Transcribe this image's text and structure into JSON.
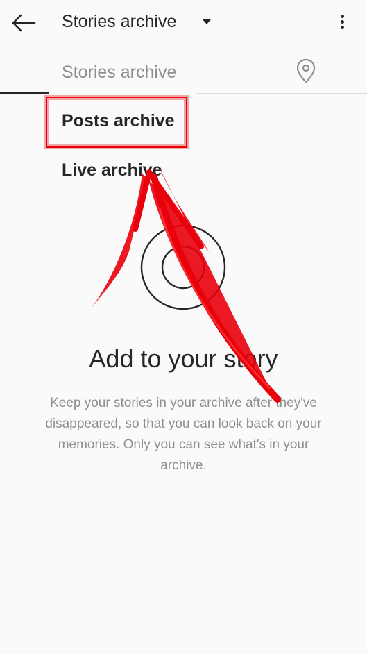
{
  "header": {
    "title": "Stories archive",
    "back_icon": "arrow-left-icon",
    "menu_icon": "more-vertical-icon",
    "caret_icon": "caret-down-icon"
  },
  "tabs": {
    "location_icon": "map-pin-icon"
  },
  "dropdown": {
    "current": "Stories archive",
    "items": [
      {
        "label": "Posts archive"
      },
      {
        "label": "Live archive"
      }
    ]
  },
  "empty_state": {
    "icon": "archive-clock-icon",
    "title": "Add to your story",
    "description": "Keep your stories in your archive after they've disappeared, so that you can look back on your memories. Only you can see what's in your archive."
  },
  "annotation": {
    "color": "#e8000b",
    "highlight_target": "Posts archive"
  }
}
